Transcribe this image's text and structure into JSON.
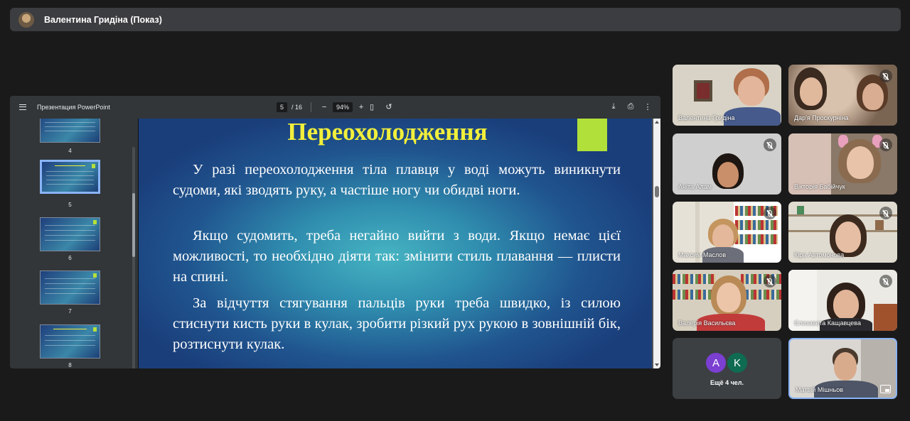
{
  "presenter_bar": {
    "title": "Валентина Гридіна (Показ)"
  },
  "viewer": {
    "doc_title": "Презентация PowerPoint",
    "page_current": "5",
    "page_total": "/ 16",
    "zoom": "94%",
    "zoom_out": "−",
    "zoom_in": "+",
    "icons": [
      "menu-icon",
      "fit-page-icon",
      "rotate-icon",
      "download-icon",
      "print-icon",
      "more-vert-icon"
    ],
    "thumbnails": [
      {
        "num": "4"
      },
      {
        "num": "5"
      },
      {
        "num": "6"
      },
      {
        "num": "7"
      },
      {
        "num": "8"
      }
    ]
  },
  "slide": {
    "title": "Переохолодження",
    "paragraphs": [
      "У разі переохолодження тіла плавця у воді можуть виникнути судоми, які зводять руку, а частіше ногу чи обидві ноги.",
      "Якщо судомить, треба негайно вийти з води. Якщо немає цієї можливості, то необхідно діяти так: змінити стиль плавання — плисти на спині.",
      "За відчуття стягування пальців руки треба швидко, із силою стиснути кисть руки в кулак, зробити різкий рух рукою в зовнішній бік, розтиснути кулак."
    ]
  },
  "participants": [
    {
      "name": "Валентина Гридіна",
      "muted": false
    },
    {
      "name": "Дар'я Проскурніна",
      "muted": true
    },
    {
      "name": "Аніта Алам",
      "muted": true
    },
    {
      "name": "Вікторія Бабійчук",
      "muted": true
    },
    {
      "name": "Максим Маслов",
      "muted": true
    },
    {
      "name": "Кіра Автомонова",
      "muted": true
    },
    {
      "name": "Валерія Васильєва",
      "muted": true
    },
    {
      "name": "Єлизавета Кащавцева",
      "muted": true
    },
    {
      "name": "Матвій Мішньов",
      "muted": false
    }
  ],
  "more": {
    "avatars": [
      {
        "letter": "A",
        "color": "#7b3fd1"
      },
      {
        "letter": "K",
        "color": "#0f6b52"
      }
    ],
    "label": "Ещё 4 чел."
  }
}
